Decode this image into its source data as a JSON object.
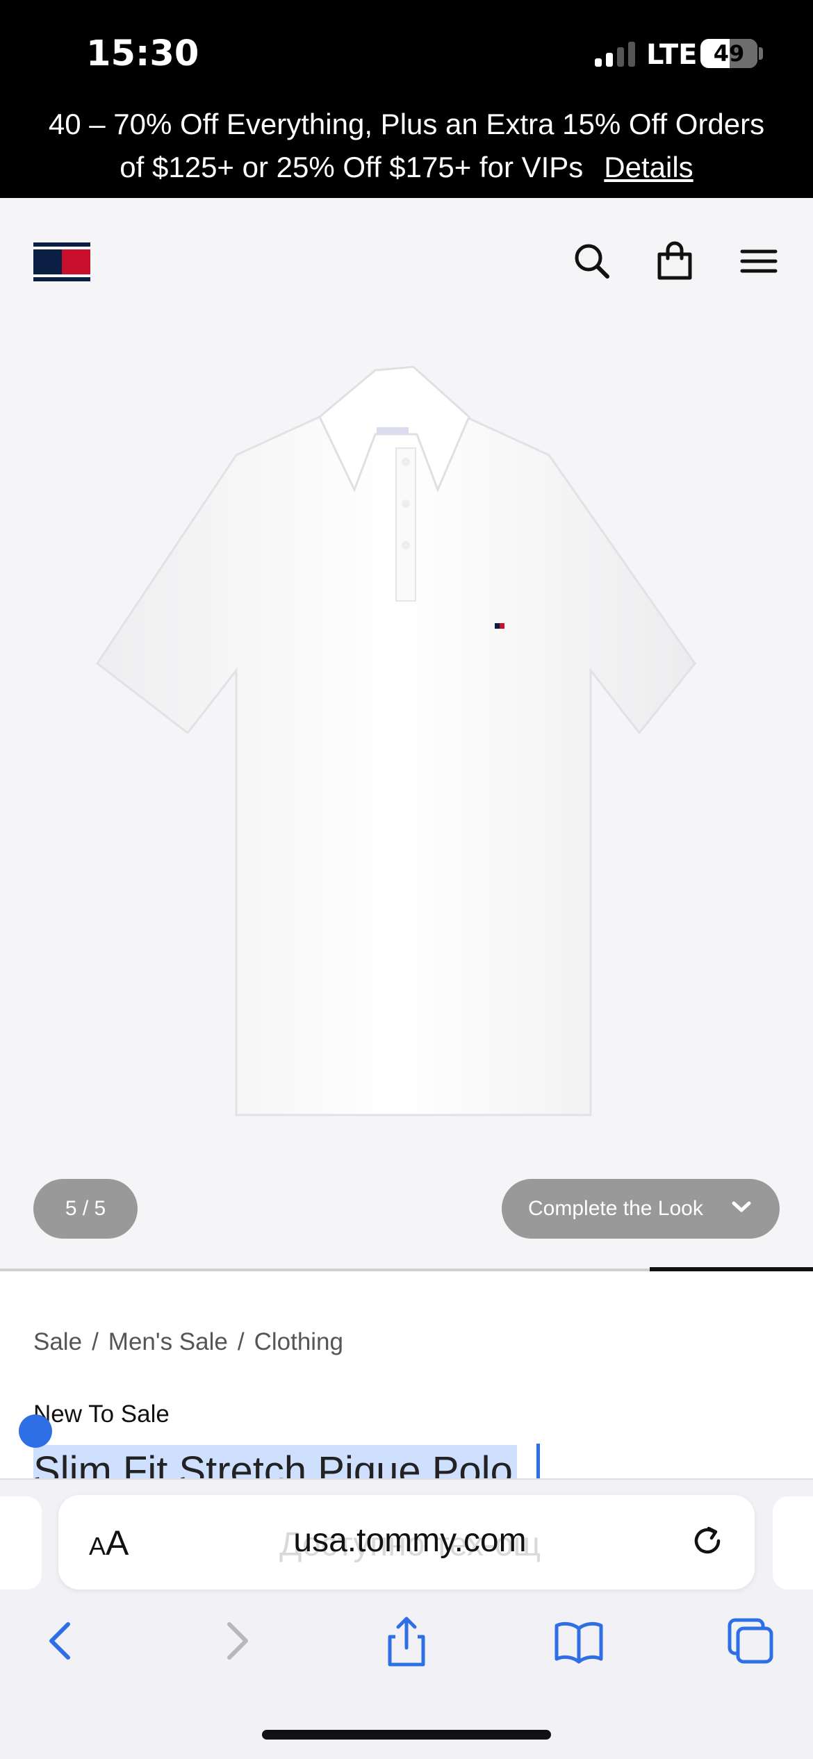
{
  "status_bar": {
    "time": "15:30",
    "network": "LTE",
    "battery": "49"
  },
  "promo": {
    "line1": "40 – 70% Off Everything, Plus an Extra 15% Off Orders",
    "line2": "of $125+ or 25% Off $175+ for VIPs",
    "details_link": "Details"
  },
  "header": {
    "logo": "tommy-flag-logo",
    "icons": [
      "search-icon",
      "bag-icon",
      "menu-icon"
    ]
  },
  "gallery": {
    "counter": "5 / 5",
    "complete_look": "Complete the Look",
    "progress": 0.2
  },
  "product": {
    "breadcrumb": [
      "Sale",
      "Men's Sale",
      "Clothing"
    ],
    "label": "New To Sale",
    "title": "Slim Fit Stretch Pique Polo"
  },
  "browser": {
    "text_size": "AA",
    "url": "usa.tommy.com",
    "ghost_text": "Доступно тех-ощ"
  },
  "colors": {
    "accent": "#2f6fe6",
    "brand_navy": "#0b1f45",
    "brand_red": "#c8102e"
  }
}
